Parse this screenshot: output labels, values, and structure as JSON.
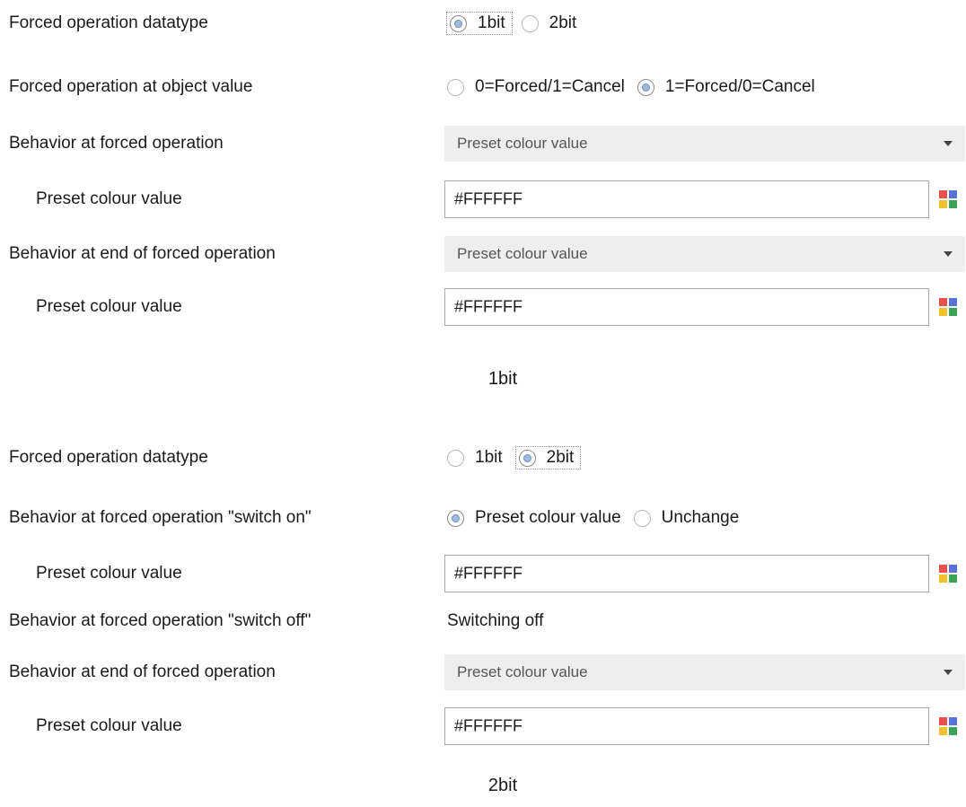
{
  "section1": {
    "datatype": {
      "label": "Forced operation datatype",
      "options": [
        "1bit",
        "2bit"
      ],
      "selected": 0
    },
    "object_value": {
      "label": "Forced operation at object value",
      "options": [
        "0=Forced/1=Cancel",
        "1=Forced/0=Cancel"
      ],
      "selected": 1
    },
    "behavior_forced": {
      "label": "Behavior at forced operation",
      "value": "Preset colour value"
    },
    "preset1": {
      "label": "Preset colour value",
      "value": "#FFFFFF"
    },
    "behavior_end": {
      "label": "Behavior at end of forced operation",
      "value": "Preset colour value"
    },
    "preset2": {
      "label": "Preset colour value",
      "value": "#FFFFFF"
    },
    "caption": "1bit"
  },
  "section2": {
    "datatype": {
      "label": "Forced operation datatype",
      "options": [
        "1bit",
        "2bit"
      ],
      "selected": 1
    },
    "switch_on": {
      "label": "Behavior at forced operation \"switch on\"",
      "options": [
        "Preset colour value",
        "Unchange"
      ],
      "selected": 0
    },
    "preset1": {
      "label": "Preset colour value",
      "value": "#FFFFFF"
    },
    "switch_off": {
      "label": "Behavior at forced operation \"switch off\"",
      "value": "Switching off"
    },
    "behavior_end": {
      "label": "Behavior at end of forced operation",
      "value": "Preset colour value"
    },
    "preset2": {
      "label": "Preset colour value",
      "value": "#FFFFFF"
    },
    "caption": "2bit"
  },
  "colors": {
    "select_bg": "#eeeeee",
    "radio_dot": "#9fb9dc",
    "palette": [
      "#e8514b",
      "#5872d8",
      "#f2c12e",
      "#3aa357"
    ]
  }
}
